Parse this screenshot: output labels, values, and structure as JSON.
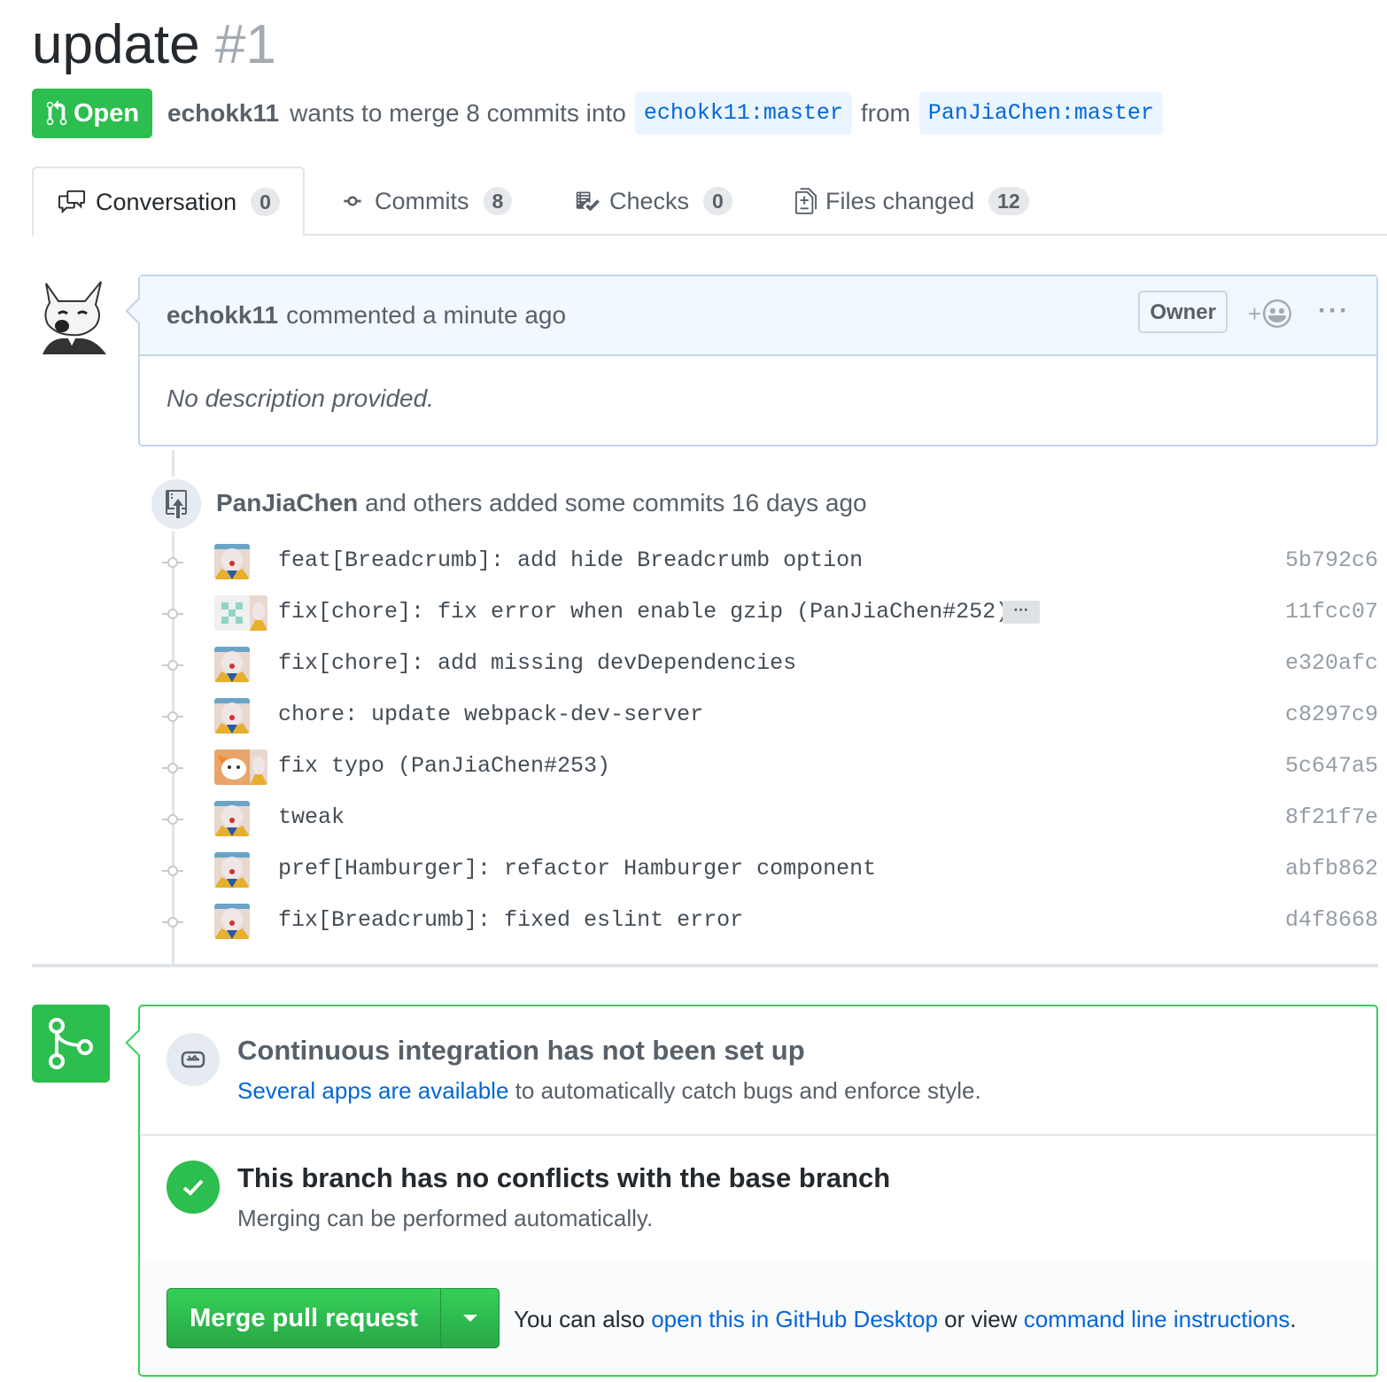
{
  "pr": {
    "title": "update",
    "number": "#1",
    "state": "Open",
    "author": "echokk11",
    "summary_mid": "wants to merge 8 commits into",
    "base_branch": "echokk11:master",
    "from_word": "from",
    "head_branch": "PanJiaChen:master"
  },
  "tabs": [
    {
      "label": "Conversation",
      "count": "0"
    },
    {
      "label": "Commits",
      "count": "8"
    },
    {
      "label": "Checks",
      "count": "0"
    },
    {
      "label": "Files changed",
      "count": "12"
    }
  ],
  "comment": {
    "author": "echokk11",
    "action": "commented a minute ago",
    "badge": "Owner",
    "react_plus": "+",
    "more": "···",
    "body": "No description provided."
  },
  "timeline": {
    "author": "PanJiaChen",
    "text": "and others added some commits 16 days ago"
  },
  "commits": [
    {
      "message": "feat[Breadcrumb]: add hide Breadcrumb option",
      "sha": "5b792c6"
    },
    {
      "message": "fix[chore]: fix error when enable gzip (PanJiaChen#252)",
      "sha": "11fcc07",
      "ellipsis": "···"
    },
    {
      "message": "fix[chore]: add missing devDependencies",
      "sha": "e320afc"
    },
    {
      "message": "chore: update webpack-dev-server",
      "sha": "c8297c9"
    },
    {
      "message": "fix typo (PanJiaChen#253)",
      "sha": "5c647a5"
    },
    {
      "message": "tweak",
      "sha": "8f21f7e"
    },
    {
      "message": "pref[Hamburger]: refactor Hamburger component",
      "sha": "abfb862"
    },
    {
      "message": "fix[Breadcrumb]: fixed eslint error",
      "sha": "d4f8668"
    }
  ],
  "merge": {
    "ci_title": "Continuous integration has not been set up",
    "ci_link": "Several apps are available",
    "ci_rest": "to automatically catch bugs and enforce style.",
    "ok_title": "This branch has no conflicts with the base branch",
    "ok_sub": "Merging can be performed automatically.",
    "button": "Merge pull request",
    "alt_pre": "You can also",
    "alt_link1": "open this in GitHub Desktop",
    "alt_mid": "or view",
    "alt_link2": "command line instructions",
    "alt_end": "."
  },
  "colors": {
    "green": "#2cbe4e",
    "link": "#0366d6",
    "header_blue": "#f1f8ff"
  }
}
